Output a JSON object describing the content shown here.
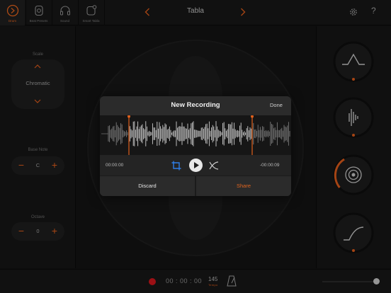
{
  "app": {
    "title": "Tabla",
    "accent": "#e0601c",
    "toolbar": [
      {
        "label": "Drum",
        "icon": "drum-icon",
        "active": true
      },
      {
        "label": "Beat Presets",
        "icon": "beat-presets-icon",
        "active": false
      },
      {
        "label": "Sound",
        "icon": "headphones-icon",
        "active": false
      },
      {
        "label": "Smart Tabla",
        "icon": "smart-tabla-icon",
        "active": false
      }
    ]
  },
  "left_panel": {
    "scale_label": "Scale",
    "scale_value": "Chromatic",
    "base_note_label": "Base Note",
    "base_note_value": "C",
    "octave_label": "Octave",
    "octave_value": "0"
  },
  "transport": {
    "timecode": "00 : 00 : 00",
    "tempo": "145",
    "tempo_unit": "Tempo"
  },
  "dialog": {
    "title": "New Recording",
    "done_label": "Done",
    "time_start": "00:00:00",
    "time_end": "-00:00:09",
    "discard_label": "Discard",
    "share_label": "Share"
  }
}
